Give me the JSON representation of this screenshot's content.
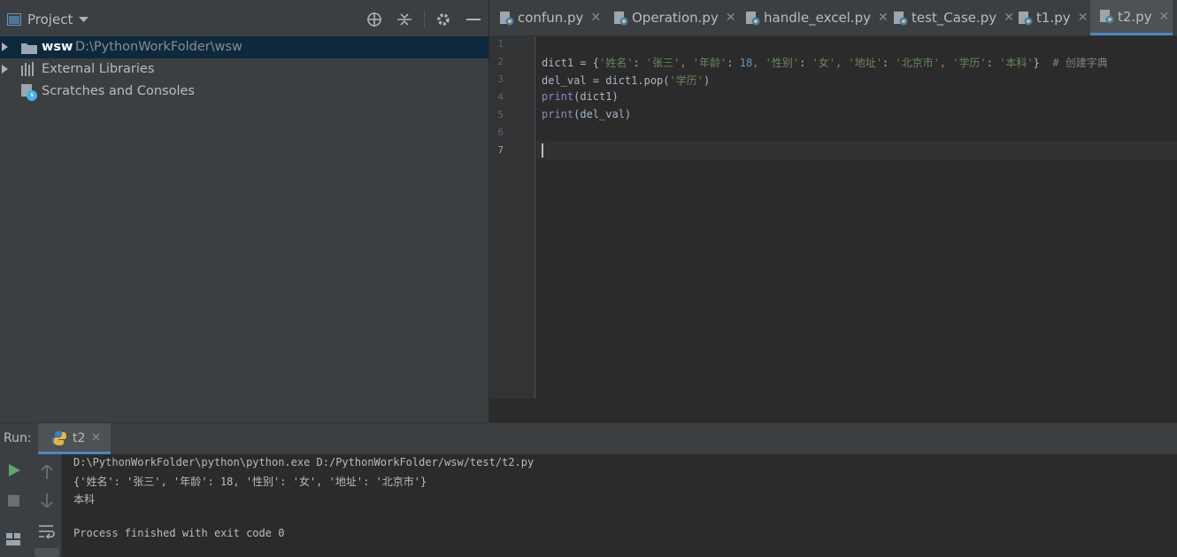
{
  "project": {
    "title": "Project",
    "tree": [
      {
        "name": "wsw",
        "path": "D:\\PythonWorkFolder\\wsw"
      },
      {
        "name": "External Libraries"
      },
      {
        "name": "Scratches and Consoles"
      }
    ]
  },
  "tabs": [
    {
      "label": "confun.py",
      "active": false
    },
    {
      "label": "Operation.py",
      "active": false
    },
    {
      "label": "handle_excel.py",
      "active": false
    },
    {
      "label": "test_Case.py",
      "active": false
    },
    {
      "label": "t1.py",
      "active": false
    },
    {
      "label": "t2.py",
      "active": true
    }
  ],
  "editor": {
    "line_numbers": [
      "1",
      "2",
      "3",
      "4",
      "5",
      "6",
      "7"
    ],
    "code": {
      "line2": {
        "var": "dict1 = {",
        "k1": "'姓名'",
        "sep1": ": ",
        "v1": "'张三'",
        "c1": ", ",
        "k2": "'年龄'",
        "sep2": ": ",
        "v2": "18",
        "c2": ", ",
        "k3": "'性别'",
        "sep3": ": ",
        "v3": "'女'",
        "c3": ", ",
        "k4": "'地址'",
        "sep4": ": ",
        "v4": "'北京市'",
        "c4": ", ",
        "k5": "'学历'",
        "sep5": ": ",
        "v5": "'本科'",
        "end": "}",
        "comment": "  # 创建字典"
      },
      "line3": {
        "pre": "del_val = dict1.pop(",
        "arg": "'学历'",
        "post": ")"
      },
      "line4": {
        "fn": "print",
        "rest": "(dict1)"
      },
      "line5": {
        "fn": "print",
        "rest": "(del_val)"
      }
    }
  },
  "run": {
    "label": "Run:",
    "tab": "t2",
    "output": [
      "D:\\PythonWorkFolder\\python\\python.exe D:/PythonWorkFolder/wsw/test/t2.py",
      "{'姓名': '张三', '年龄': 18, '性别': '女', '地址': '北京市'}",
      "本科",
      "",
      "Process finished with exit code 0"
    ]
  },
  "colors": {
    "selection": "#0d293e",
    "accent": "#4a88c7",
    "string": "#6a8759",
    "number": "#6897bb",
    "builtin": "#8888c6",
    "comment": "#808080"
  }
}
